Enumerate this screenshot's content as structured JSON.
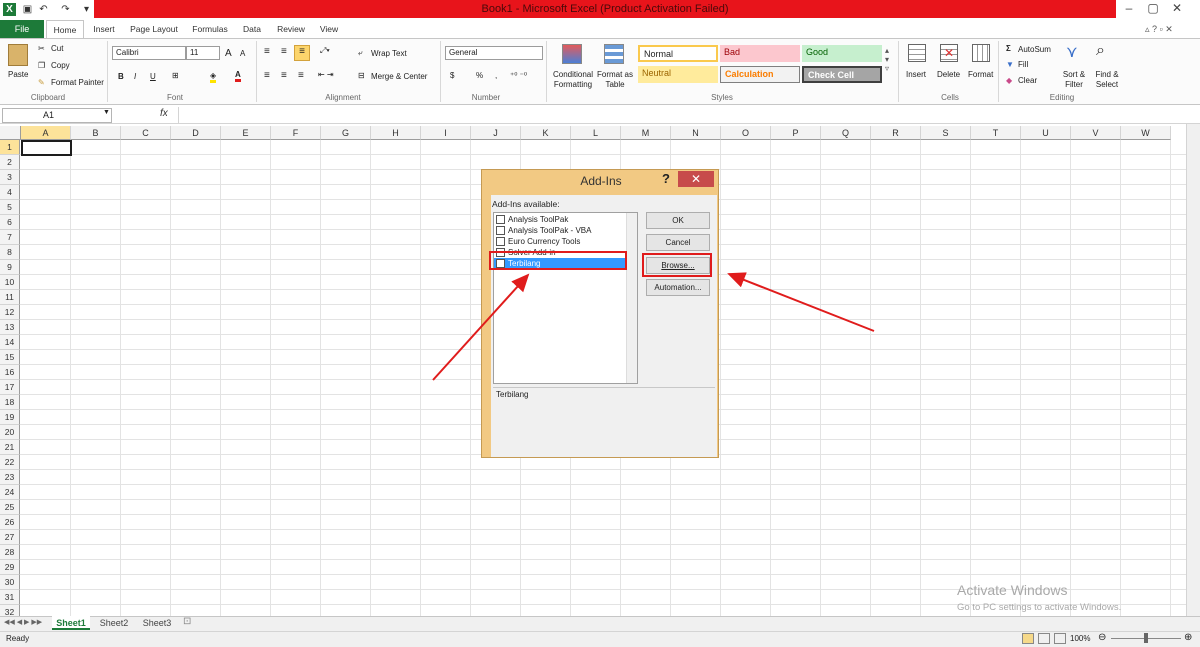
{
  "window": {
    "title": "Book1 - Microsoft Excel (Product Activation Failed)",
    "controls": [
      "–",
      "▢",
      "✕"
    ]
  },
  "ribbon": {
    "tabs": [
      "File",
      "Home",
      "Insert",
      "Page Layout",
      "Formulas",
      "Data",
      "Review",
      "View"
    ],
    "clipboard": {
      "paste": "Paste",
      "cut": "Cut",
      "copy": "Copy",
      "format_painter": "Format Painter",
      "label": "Clipboard"
    },
    "font": {
      "name": "Calibri",
      "size": "11",
      "bold": "B",
      "italic": "I",
      "underline": "U",
      "grow": "A",
      "label": "Font"
    },
    "alignment": {
      "wrap": "Wrap Text",
      "merge": "Merge & Center",
      "label": "Alignment"
    },
    "number": {
      "format": "General",
      "currency": "$",
      "percent": "%",
      "comma": ",",
      "label": "Number"
    },
    "styles": {
      "conditional": "Conditional Formatting",
      "format_table": "Format as Table",
      "normal": "Normal",
      "bad": "Bad",
      "good": "Good",
      "neutral": "Neutral",
      "calculation": "Calculation",
      "check_cell": "Check Cell",
      "label": "Styles"
    },
    "cells": {
      "insert": "Insert",
      "delete": "Delete",
      "format": "Format",
      "label": "Cells"
    },
    "editing": {
      "autosum": "AutoSum",
      "fill": "Fill",
      "clear": "Clear",
      "sort": "Sort & Filter",
      "find": "Find & Select",
      "label": "Editing"
    }
  },
  "formula_bar": {
    "name_box": "A1",
    "fx": "fx",
    "value": ""
  },
  "grid": {
    "columns": [
      "A",
      "B",
      "C",
      "D",
      "E",
      "F",
      "G",
      "H",
      "I",
      "J",
      "K",
      "L",
      "M",
      "N",
      "O",
      "P",
      "Q",
      "R",
      "S",
      "T",
      "U",
      "V",
      "W"
    ],
    "rows": [
      "1",
      "2",
      "3",
      "4",
      "5",
      "6",
      "7",
      "8",
      "9",
      "10",
      "11",
      "12",
      "13",
      "14",
      "15",
      "16",
      "17",
      "18",
      "19",
      "20",
      "21",
      "22",
      "23",
      "24",
      "25",
      "26",
      "27",
      "28",
      "29",
      "30",
      "31",
      "32"
    ],
    "selected": "A1"
  },
  "sheets": {
    "tabs": [
      "Sheet1",
      "Sheet2",
      "Sheet3"
    ],
    "active": "Sheet1"
  },
  "status": {
    "ready": "Ready",
    "zoom": "100%"
  },
  "watermark": {
    "line1": "Activate Windows",
    "line2": "Go to PC settings to activate Windows."
  },
  "dialog": {
    "title": "Add-Ins",
    "help": "?",
    "close": "✕",
    "available_label": "Add-Ins available:",
    "items": [
      {
        "label": "Analysis ToolPak",
        "checked": false
      },
      {
        "label": "Analysis ToolPak - VBA",
        "checked": false
      },
      {
        "label": "Euro Currency Tools",
        "checked": false
      },
      {
        "label": "Solver Add-in",
        "checked": false
      },
      {
        "label": "Terbilang",
        "checked": true
      }
    ],
    "description": "Terbilang",
    "buttons": {
      "ok": "OK",
      "cancel": "Cancel",
      "browse": "Browse...",
      "automation": "Automation..."
    }
  },
  "colors": {
    "title_highlight": "#e8141b",
    "file_tab": "#1d7a39",
    "dialog_frame": "#f2c983",
    "annotation": "#e01c1c",
    "selected_item": "#3399ff"
  }
}
